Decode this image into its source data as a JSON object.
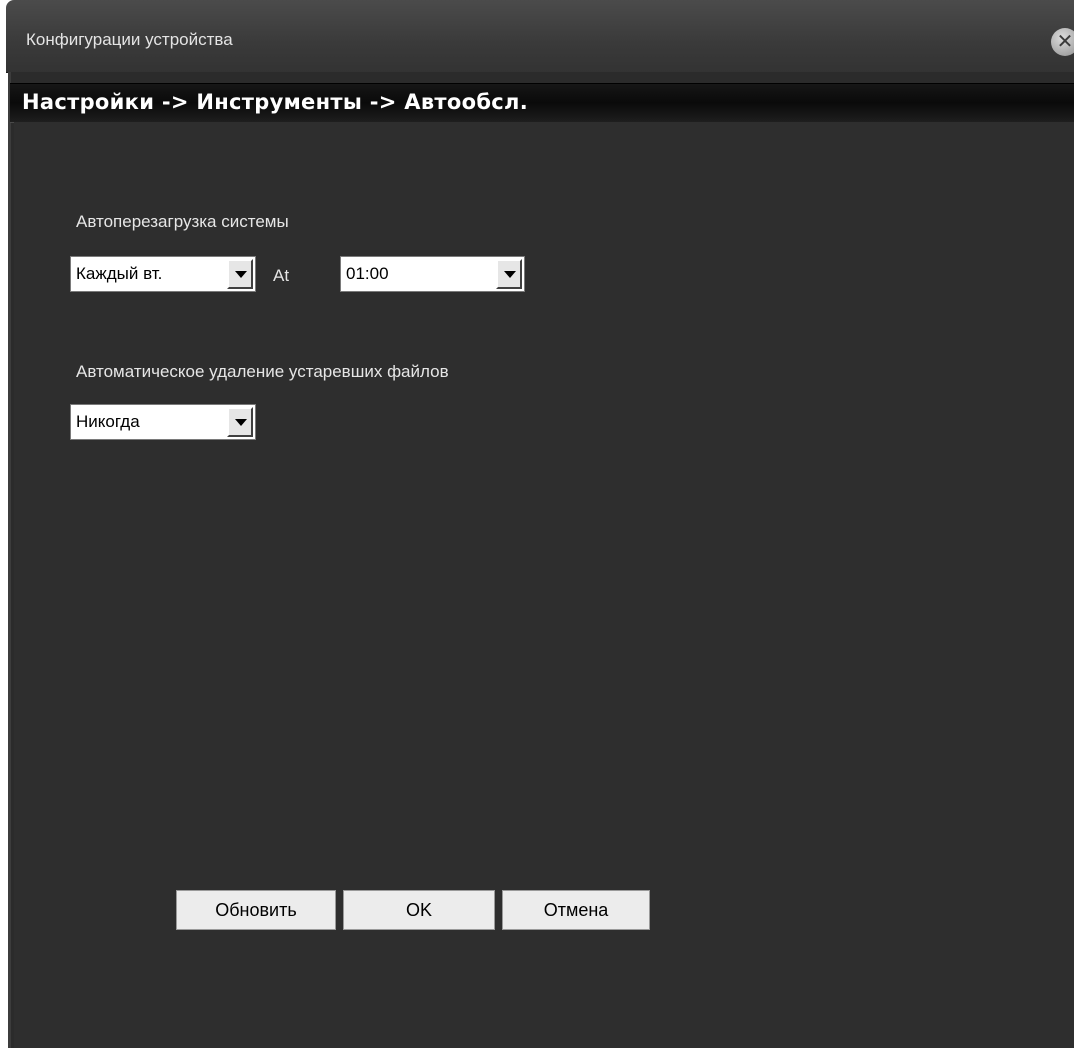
{
  "window": {
    "title": "Конфигурации устройства",
    "close_glyph": "✕"
  },
  "breadcrumb": "Настройки -> Инструменты -> Автообсл.",
  "auto_reboot": {
    "label": "Автоперезагрузка системы",
    "day_value": "Каждый вт.",
    "at_label": "At",
    "time_value": "01:00"
  },
  "auto_delete": {
    "label": "Автоматическое удаление устаревших файлов",
    "value": "Никогда"
  },
  "buttons": {
    "refresh": "Обновить",
    "ok": "OK",
    "cancel": "Отмена"
  },
  "colors": {
    "background": "#2e2e2e",
    "titlebar": "#3f3f3f",
    "breadcrumb_bar": "#0f0f0f",
    "text": "#e6e6e6"
  }
}
